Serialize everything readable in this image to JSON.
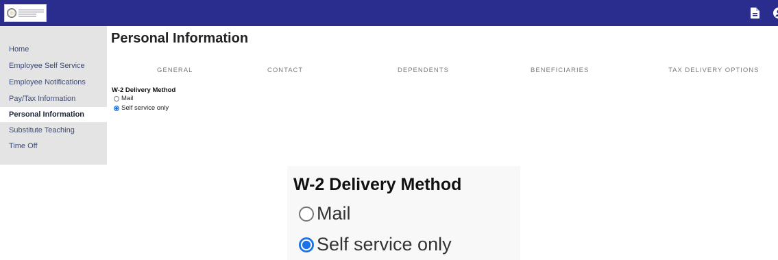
{
  "header": {
    "logo_name": "district-seal-logo",
    "icons": [
      "document-icon",
      "user-icon"
    ],
    "bar_color": "#2b2d8e"
  },
  "sidebar": {
    "items": [
      {
        "label": "Home"
      },
      {
        "label": "Employee Self Service"
      },
      {
        "label": "Employee Notifications"
      },
      {
        "label": "Pay/Tax Information"
      },
      {
        "label": "Personal Information",
        "active": true
      },
      {
        "label": "Substitute Teaching"
      },
      {
        "label": "Time Off"
      }
    ]
  },
  "main": {
    "title": "Personal Information",
    "tabs": [
      {
        "label": "GENERAL"
      },
      {
        "label": "CONTACT"
      },
      {
        "label": "DEPENDENTS"
      },
      {
        "label": "BENEFICIARIES"
      },
      {
        "label": "TAX DELIVERY OPTIONS"
      }
    ],
    "w2": {
      "heading": "W-2 Delivery Method",
      "options": [
        {
          "label": "Mail",
          "checked": false
        },
        {
          "label": "Self service only",
          "checked": true
        }
      ]
    }
  },
  "zoom_inset": {
    "heading": "W-2 Delivery Method",
    "options": [
      {
        "label": "Mail",
        "checked": false
      },
      {
        "label": "Self service only",
        "checked": true
      }
    ]
  },
  "colors": {
    "accent": "#1a73e8",
    "sidebar_bg": "#e4e4e4"
  }
}
